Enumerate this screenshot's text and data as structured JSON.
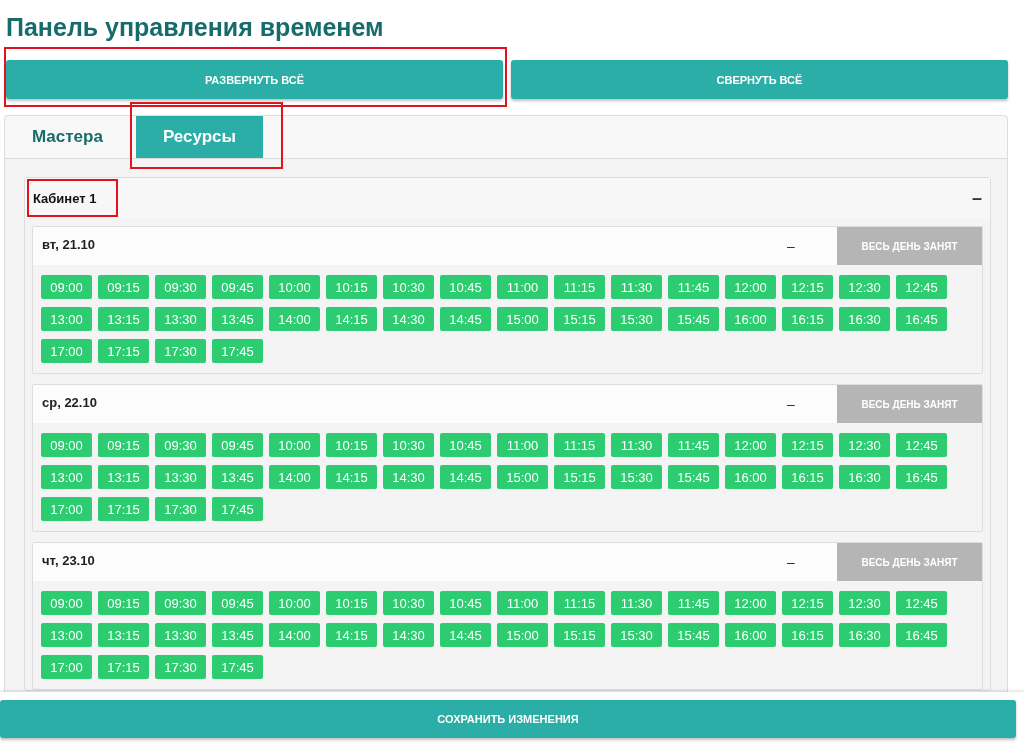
{
  "title": "Панель управления временем",
  "actions": [
    {
      "label": "РАЗВЕРНУТЬ ВСЁ",
      "highlighted": true
    },
    {
      "label": "СВЕРНУТЬ ВСЁ",
      "highlighted": false
    }
  ],
  "tabs": [
    {
      "label": "Мастера",
      "selected": false,
      "highlighted": false
    },
    {
      "label": "Ресурсы",
      "selected": true,
      "highlighted": true
    }
  ],
  "resource": {
    "name": "Кабинет 1",
    "highlighted": true,
    "toggle": "–",
    "days": [
      {
        "date": "вт, 21.10",
        "toggle": "–",
        "busy_button": "ВЕСЬ ДЕНЬ ЗАНЯТ",
        "slots": [
          "09:00",
          "09:15",
          "09:30",
          "09:45",
          "10:00",
          "10:15",
          "10:30",
          "10:45",
          "11:00",
          "11:15",
          "11:30",
          "11:45",
          "12:00",
          "12:15",
          "12:30",
          "12:45",
          "13:00",
          "13:15",
          "13:30",
          "13:45",
          "14:00",
          "14:15",
          "14:30",
          "14:45",
          "15:00",
          "15:15",
          "15:30",
          "15:45",
          "16:00",
          "16:15",
          "16:30",
          "16:45",
          "17:00",
          "17:15",
          "17:30",
          "17:45"
        ]
      },
      {
        "date": "ср, 22.10",
        "toggle": "–",
        "busy_button": "ВЕСЬ ДЕНЬ ЗАНЯТ",
        "slots": [
          "09:00",
          "09:15",
          "09:30",
          "09:45",
          "10:00",
          "10:15",
          "10:30",
          "10:45",
          "11:00",
          "11:15",
          "11:30",
          "11:45",
          "12:00",
          "12:15",
          "12:30",
          "12:45",
          "13:00",
          "13:15",
          "13:30",
          "13:45",
          "14:00",
          "14:15",
          "14:30",
          "14:45",
          "15:00",
          "15:15",
          "15:30",
          "15:45",
          "16:00",
          "16:15",
          "16:30",
          "16:45",
          "17:00",
          "17:15",
          "17:30",
          "17:45"
        ]
      },
      {
        "date": "чт, 23.10",
        "toggle": "–",
        "busy_button": "ВЕСЬ ДЕНЬ ЗАНЯТ",
        "slots": [
          "09:00",
          "09:15",
          "09:30",
          "09:45",
          "10:00",
          "10:15",
          "10:30",
          "10:45",
          "11:00",
          "11:15",
          "11:30",
          "11:45",
          "12:00",
          "12:15",
          "12:30",
          "12:45",
          "13:00",
          "13:15",
          "13:30",
          "13:45",
          "14:00",
          "14:15",
          "14:30",
          "14:45",
          "15:00",
          "15:15",
          "15:30",
          "15:45",
          "16:00",
          "16:15",
          "16:30",
          "16:45",
          "17:00",
          "17:15",
          "17:30",
          "17:45"
        ]
      }
    ]
  },
  "save_button": "СОХРАНИТЬ ИЗМЕНЕНИЯ"
}
